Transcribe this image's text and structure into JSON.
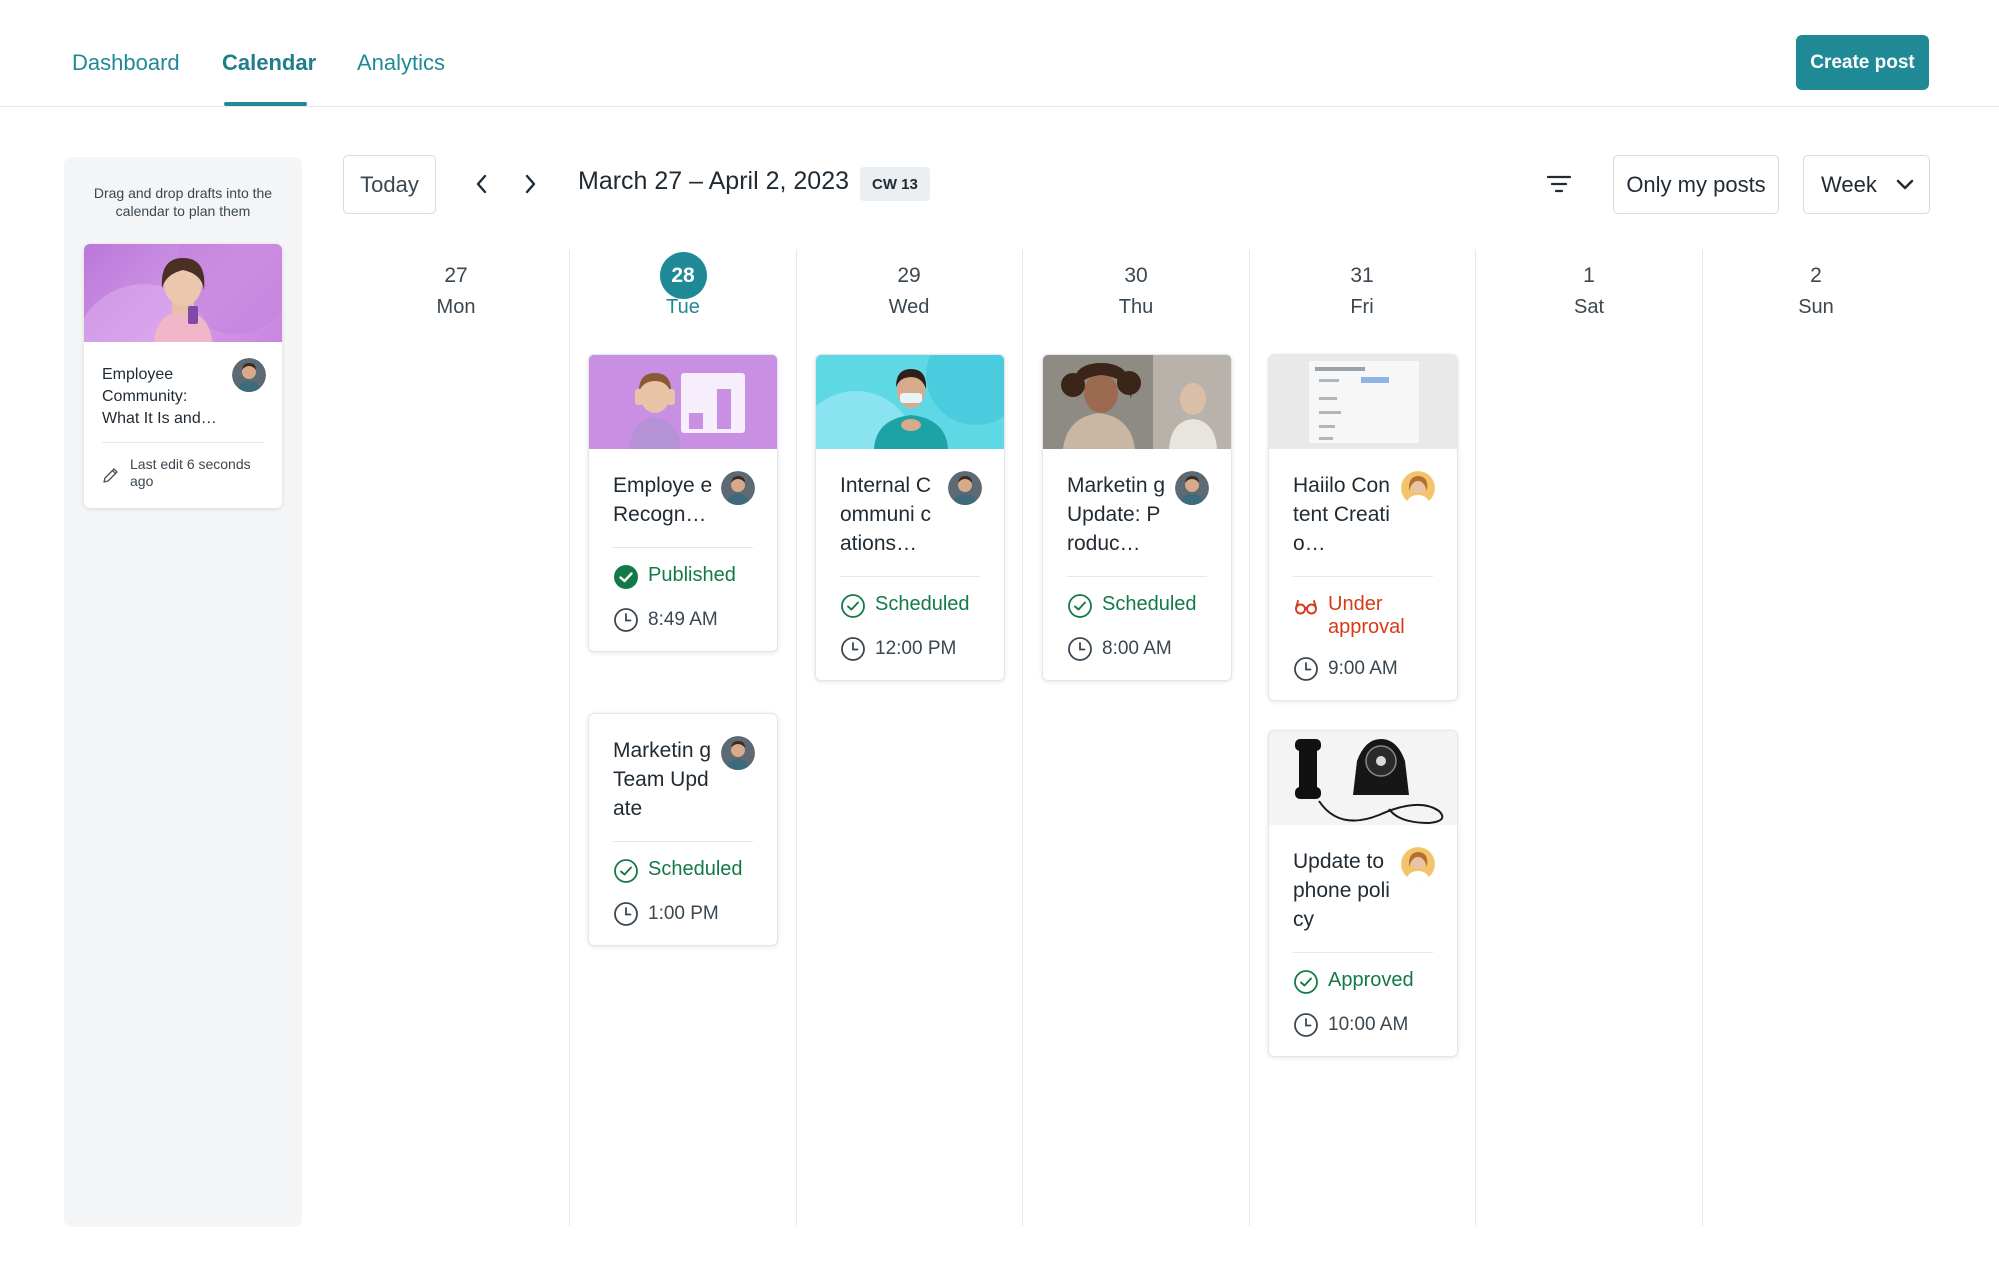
{
  "nav": {
    "tabs": [
      {
        "label": "Dashboard",
        "active": false
      },
      {
        "label": "Calendar",
        "active": true
      },
      {
        "label": "Analytics",
        "active": false
      }
    ],
    "create_label": "Create post"
  },
  "colors": {
    "accent": "#1f8a96",
    "success": "#137a47",
    "warning": "#d63a16"
  },
  "drafts": {
    "hint": "Drag and drop drafts into the calendar to plan them",
    "items": [
      {
        "title": "Employee Community: What It Is and…",
        "last_edit": "Last edit 6 seconds ago",
        "icon": "pencil-icon"
      }
    ]
  },
  "toolbar": {
    "today_label": "Today",
    "range": "March 27 – April 2, 2023",
    "week_badge": "CW 13",
    "only_my_posts_label": "Only my posts",
    "view_label": "Week"
  },
  "days": [
    {
      "num": "27",
      "name": "Mon",
      "today": false
    },
    {
      "num": "28",
      "name": "Tue",
      "today": true
    },
    {
      "num": "29",
      "name": "Wed",
      "today": false
    },
    {
      "num": "30",
      "name": "Thu",
      "today": false
    },
    {
      "num": "31",
      "name": "Fri",
      "today": false
    },
    {
      "num": "1",
      "name": "Sat",
      "today": false
    },
    {
      "num": "2",
      "name": "Sun",
      "today": false
    }
  ],
  "posts": {
    "tue_1": {
      "title": "Employe e Recogn…",
      "status": "Published",
      "time": "8:49 AM"
    },
    "tue_2": {
      "title": "Marketin g Team Update",
      "status": "Scheduled",
      "time": "1:00 PM"
    },
    "wed_1": {
      "title": "Internal Communi cations…",
      "status": "Scheduled",
      "time": "12:00 PM"
    },
    "thu_1": {
      "title": "Marketin g Update: Produc…",
      "status": "Scheduled",
      "time": "8:00 AM"
    },
    "fri_1": {
      "title": "Haiilo Content Creatio…",
      "status": "Under approval",
      "time": "9:00 AM"
    },
    "fri_2": {
      "title": "Update to phone policy",
      "status": "Approved",
      "time": "10:00 AM"
    }
  }
}
